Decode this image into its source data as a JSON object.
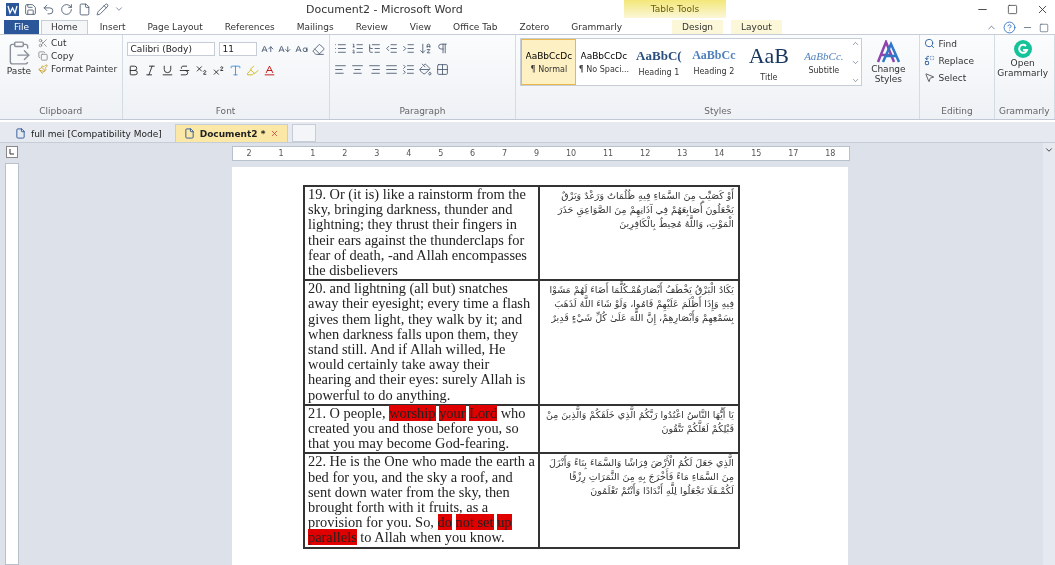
{
  "window": {
    "title": "Document2 - Microsoft Word",
    "contextual_header": "Table Tools"
  },
  "ribbon_tabs": [
    {
      "label": "File",
      "kind": "file",
      "selected": false
    },
    {
      "label": "Home",
      "kind": "tab",
      "selected": true
    },
    {
      "label": "Insert",
      "kind": "tab",
      "selected": false
    },
    {
      "label": "Page Layout",
      "kind": "tab",
      "selected": false
    },
    {
      "label": "References",
      "kind": "tab",
      "selected": false
    },
    {
      "label": "Mailings",
      "kind": "tab",
      "selected": false
    },
    {
      "label": "Review",
      "kind": "tab",
      "selected": false
    },
    {
      "label": "View",
      "kind": "tab",
      "selected": false
    },
    {
      "label": "Office Tab",
      "kind": "tab",
      "selected": false
    },
    {
      "label": "Zotero",
      "kind": "tab",
      "selected": false
    },
    {
      "label": "Grammarly",
      "kind": "tab",
      "selected": false
    },
    {
      "label": "Design",
      "kind": "contextual",
      "selected": false
    },
    {
      "label": "Layout",
      "kind": "contextual",
      "selected": false
    }
  ],
  "clipboard": {
    "paste": "Paste",
    "cut": "Cut",
    "copy": "Copy",
    "format_painter": "Format Painter",
    "group": "Clipboard"
  },
  "font": {
    "name": "Calibri (Body)",
    "size": "11",
    "group": "Font"
  },
  "paragraph": {
    "group": "Paragraph"
  },
  "styles": {
    "items": [
      {
        "preview": "AaBbCcDc",
        "label": "¶ Normal",
        "kind": "normal",
        "selected": true
      },
      {
        "preview": "AaBbCcDc",
        "label": "¶ No Spaci...",
        "kind": "normal",
        "selected": false
      },
      {
        "preview": "AaBbC(",
        "label": "Heading 1",
        "kind": "heading1",
        "selected": false
      },
      {
        "preview": "AaBbCc",
        "label": "Heading 2",
        "kind": "heading2",
        "selected": false
      },
      {
        "preview": "AaB",
        "label": "Title",
        "kind": "title",
        "selected": false
      },
      {
        "preview": "AaBbCc.",
        "label": "Subtitle",
        "kind": "subtitle",
        "selected": false
      }
    ],
    "change_styles": "Change Styles",
    "group": "Styles"
  },
  "editing": {
    "find": "Find",
    "replace": "Replace",
    "select": "Select",
    "group": "Editing"
  },
  "grammarly": {
    "open": "Open Grammarly",
    "group": "Grammarly"
  },
  "document_tabs": [
    {
      "label": "full mei [Compatibility Mode]",
      "selected": false
    },
    {
      "label": "Document2 *",
      "selected": true
    }
  ],
  "ruler": {
    "ticks": [
      "2",
      "1",
      "1",
      "2",
      "3",
      "4",
      "5",
      "6",
      "7",
      "9",
      "10",
      "11",
      "12",
      "13",
      "14",
      "15",
      "17",
      "18"
    ]
  },
  "table": {
    "rows": [
      {
        "english": [
          {
            "text": "19. Or (it is) like a rainstorm from the sky, bringing darkness, thunder and lightning; they thrust their fingers in their ears against the thunderclaps for fear of death, -and Allah encompasses the disbelievers",
            "highlighted": false
          }
        ],
        "arabic": "أَوْ كَصَيِّبٍ مِنَ السَّمَاءِ فِيهِ ظُلُمَاتٌ وَرَعْدٌ وَبَرْقٌ يَجْعَلُونَ أَصَابِعَهُمْ فِي آذَانِهِمْ مِنَ الصَّوَاعِقِ حَذَرَ الْمَوْتِ، وَاللَّهُ مُحِيطٌ بِالْكَافِرِينَ"
      },
      {
        "english": [
          {
            "text": "20. and lightning (all but) snatches away their eyesight; every time a flash gives them light, they walk by it; and when darkness falls upon them, they stand still. And if Allah willed, He would certainly take away their hearing and their eyes: surely Allah is powerful to do anything.",
            "highlighted": false
          }
        ],
        "arabic": "يَكَادُ الْبَرْقُ يَخْطَفُ أَبْصَارَهُمْـكُلَّمَا أَضَاءَ لَهُمْ مَشَوْا فِيهِ وَإِذَا أَظْلَمَ عَلَيْهِمْ قَامُوا، وَلَوْ شَاءَ اللَّهُ لَذَهَبَ بِسَمْعِهِمْ وَأَبْصَارِهِمْ، إِنَّ اللَّهَ عَلَىٰ كُلِّ شَيْءٍ قَدِيرٌ"
      },
      {
        "english": [
          {
            "text": "21. O people, ",
            "highlighted": false
          },
          {
            "text": "worship",
            "highlighted": true
          },
          {
            "text": "your",
            "highlighted": true,
            "space_before": true
          },
          {
            "text": "Lord",
            "highlighted": true,
            "space_before": true
          },
          {
            "text": " who created you and those before you, so that you may become God-fearing.",
            "highlighted": false
          }
        ],
        "arabic": "يَا أَيُّهَا النَّاسُ اعْبُدُوا رَبَّكُمُ الَّذِي خَلَقَكُمْ وَالَّذِينَ مِنْ قَبْلِكُمْ لَعَلَّكُمْ تَتَّقُونَ"
      },
      {
        "english": [
          {
            "text": "22. He is the One who made the earth a bed for you, and the sky a roof, and sent down water from the sky, then brought forth with it fruits, as a provision for you. So, ",
            "highlighted": false
          },
          {
            "text": "do",
            "highlighted": true
          },
          {
            "text": "not set",
            "highlighted": true,
            "space_before": true
          },
          {
            "text": "up parallels",
            "highlighted": true,
            "space_before": true
          },
          {
            "text": " to Allah when you know.",
            "highlighted": false
          }
        ],
        "arabic": "الَّذِي جَعَلَ لَكُمُ الْأَرْضَ فِرَاشًا وَالسَّمَاءَ بِنَاءً وَأَنْزَلَ مِنَ السَّمَاءِ مَاءً فَأَخْرَجَ بِهِ مِنَ الثَّمَرَاتِ رِزْقًا لَكُمْـفَلَا تَجْعَلُوا لِلَّهِ أَنْدَادًا وَأَنْتُمْ تَعْلَمُونَ"
      }
    ]
  }
}
